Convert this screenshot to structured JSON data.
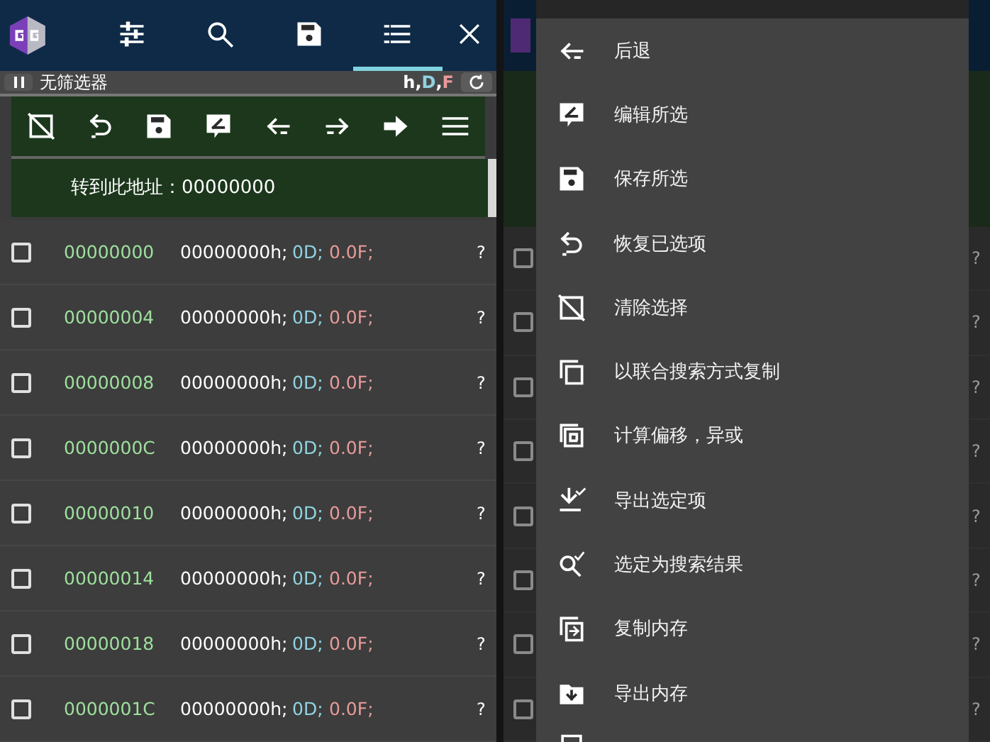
{
  "header": {
    "tabs": [
      {
        "kind": "sliders",
        "selected": false
      },
      {
        "kind": "search",
        "selected": false
      },
      {
        "kind": "save",
        "selected": false
      },
      {
        "kind": "list",
        "selected": true
      }
    ]
  },
  "filter_bar": {
    "label": "无筛选器",
    "separator": ",",
    "types": [
      {
        "text": "h",
        "color": "#ffffff"
      },
      {
        "text": "D",
        "color": "#8fd3e0"
      },
      {
        "text": "F",
        "color": "#e89a9a"
      }
    ]
  },
  "toolbar": [
    {
      "kind": "clear"
    },
    {
      "kind": "undo"
    },
    {
      "kind": "save"
    },
    {
      "kind": "edit"
    },
    {
      "kind": "prev"
    },
    {
      "kind": "next"
    },
    {
      "kind": "goto"
    },
    {
      "kind": "menu"
    }
  ],
  "goto": {
    "label": "转到此地址：00000000"
  },
  "rows": [
    {
      "address": "00000000",
      "hex": "00000000h;",
      "dword": "0D;",
      "float": "0.0F;",
      "mark": "?",
      "checked": false
    },
    {
      "address": "00000004",
      "hex": "00000000h;",
      "dword": "0D;",
      "float": "0.0F;",
      "mark": "?",
      "checked": false
    },
    {
      "address": "00000008",
      "hex": "00000000h;",
      "dword": "0D;",
      "float": "0.0F;",
      "mark": "?",
      "checked": false
    },
    {
      "address": "0000000C",
      "hex": "00000000h;",
      "dword": "0D;",
      "float": "0.0F;",
      "mark": "?",
      "checked": false
    },
    {
      "address": "00000010",
      "hex": "00000000h;",
      "dword": "0D;",
      "float": "0.0F;",
      "mark": "?",
      "checked": false
    },
    {
      "address": "00000014",
      "hex": "00000000h;",
      "dword": "0D;",
      "float": "0.0F;",
      "mark": "?",
      "checked": false
    },
    {
      "address": "00000018",
      "hex": "00000000h;",
      "dword": "0D;",
      "float": "0.0F;",
      "mark": "?",
      "checked": false
    },
    {
      "address": "0000001C",
      "hex": "00000000h;",
      "dword": "0D;",
      "float": "0.0F;",
      "mark": "?",
      "checked": false
    }
  ],
  "menu": {
    "items": [
      {
        "kind": "back",
        "label": "后退"
      },
      {
        "kind": "edit",
        "label": "编辑所选"
      },
      {
        "kind": "save",
        "label": "保存所选"
      },
      {
        "kind": "undo",
        "label": "恢复已选项"
      },
      {
        "kind": "clear",
        "label": "清除选择"
      },
      {
        "kind": "copy",
        "label": "以联合搜索方式复制"
      },
      {
        "kind": "offset",
        "label": "计算偏移，异或"
      },
      {
        "kind": "export",
        "label": "导出选定项"
      },
      {
        "kind": "searchsel",
        "label": "选定为搜索结果"
      },
      {
        "kind": "copymem",
        "label": "复制内存"
      },
      {
        "kind": "dump",
        "label": "导出内存"
      },
      {
        "kind": "partial"
      }
    ]
  },
  "behind_rows": [
    {
      "mark": "?",
      "checked": false
    },
    {
      "mark": "?",
      "checked": false
    },
    {
      "mark": "?",
      "checked": false
    },
    {
      "mark": "?",
      "checked": false
    },
    {
      "mark": "?",
      "checked": false
    },
    {
      "mark": "?",
      "checked": false
    },
    {
      "mark": "?",
      "checked": false
    },
    {
      "mark": "?",
      "checked": false
    }
  ]
}
